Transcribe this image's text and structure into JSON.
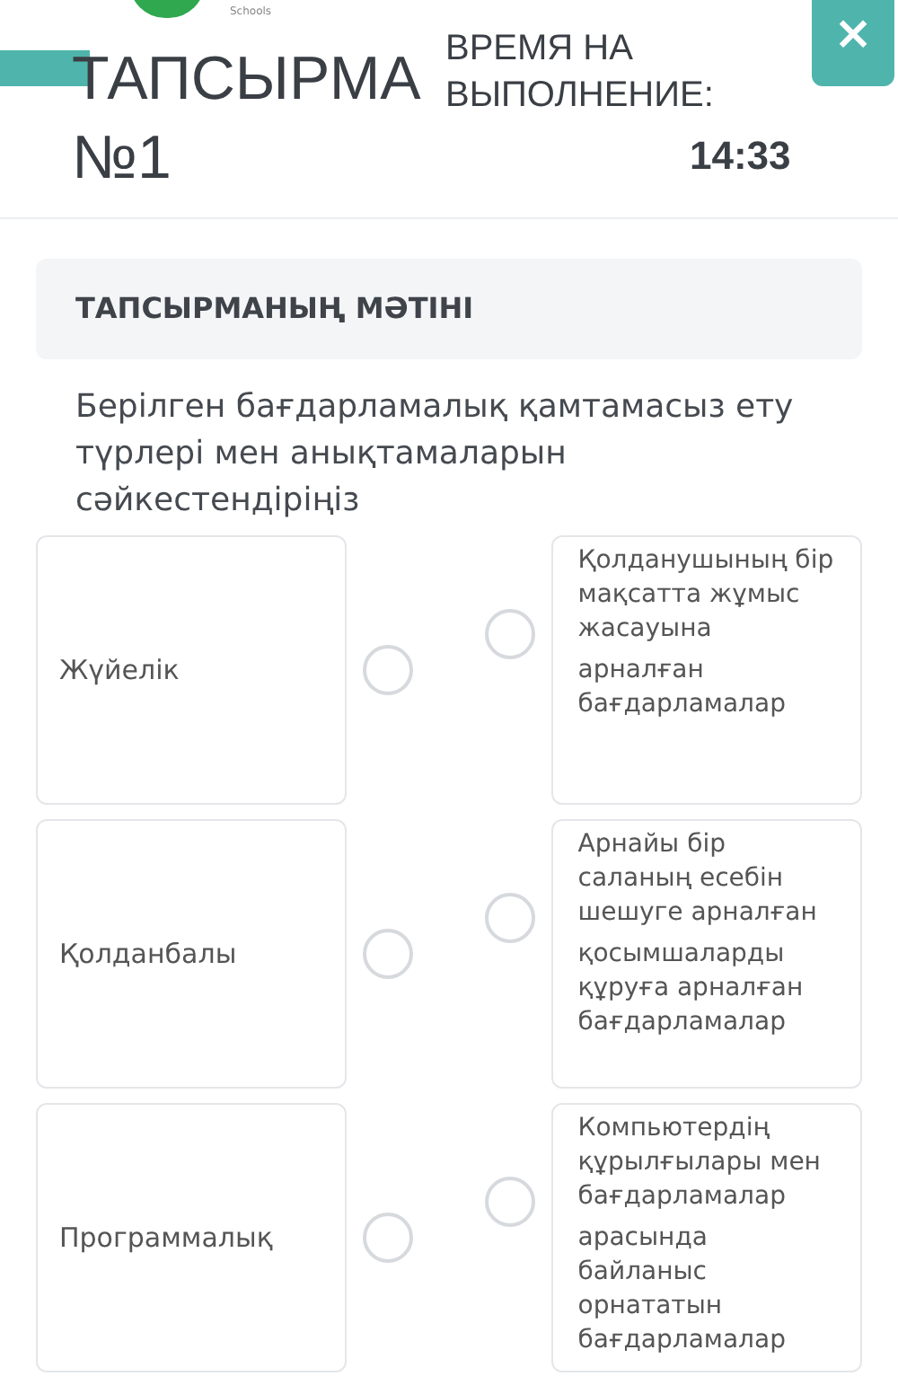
{
  "header": {
    "logo_caption": "Schools",
    "title": "ТАПСЫРМА №1",
    "timer_label": "ВРЕМЯ НА ВЫПОЛНЕНИЕ:",
    "timer_value": "14:33",
    "close": "×"
  },
  "section": {
    "title": "ТАПСЫРМАНЫҢ МӘТІНІ",
    "prompt": "Берілген бағдарламалық қамтамасыз ету түрлері мен анықтамаларын сәйкестендіріңіз"
  },
  "pairs": [
    {
      "term": "Жүйелік",
      "term_selected": false,
      "definition": [
        "Қолданушының бір мақсатта жұмыс жасауына",
        "арналған бағдарламалар"
      ],
      "definition_selected": false
    },
    {
      "term": "Қолданбалы",
      "term_selected": false,
      "definition": [
        "Арнайы бір саланың есебін шешуге арналған",
        "қосымшаларды құруға арналған бағдарламалар"
      ],
      "definition_selected": false
    },
    {
      "term": "Программалық",
      "term_selected": false,
      "definition": [
        "Компьютердің құрылғылары мен бағдарламалар",
        "арасында байланыс орнататын бағдарламалар"
      ],
      "definition_selected": false
    }
  ]
}
